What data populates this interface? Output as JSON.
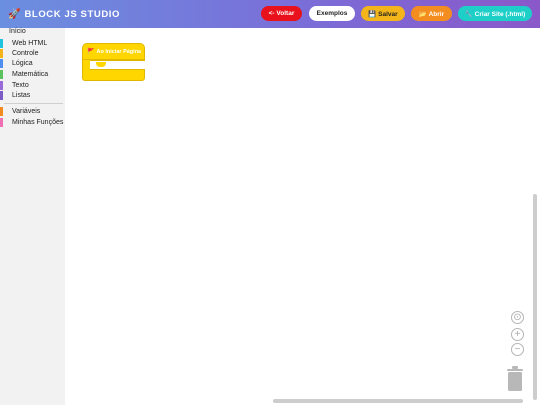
{
  "header": {
    "title": "BLOCK JS STUDIO",
    "icon": "rocket-icon",
    "gradient": [
      "#6b8fe0",
      "#8a58c9"
    ],
    "buttons": {
      "back": "<- Voltar",
      "examples": "Exemplos",
      "save": "💾 Salvar",
      "open": "📂 Abrir",
      "create": "🔧 Criar Site (.html)"
    }
  },
  "toolbox": {
    "start": "Início",
    "categories": [
      {
        "label": "Web HTML",
        "color": "#1ec3e0"
      },
      {
        "label": "Controle",
        "color": "#f4b41a"
      },
      {
        "label": "Lógica",
        "color": "#4f8ff2"
      },
      {
        "label": "Matemática",
        "color": "#5cc25e"
      },
      {
        "label": "Texto",
        "color": "#9b6ad9"
      },
      {
        "label": "Listas",
        "color": "#7b5bc5"
      }
    ],
    "extra": [
      {
        "label": "Variáveis",
        "color": "#f38a1f"
      },
      {
        "label": "Minhas Funções",
        "color": "#ef6fb5"
      }
    ]
  },
  "workspace": {
    "block": {
      "label": "Ao Iniciar Página",
      "color": "#ffd600",
      "icon": "flag-icon"
    }
  },
  "controls": {
    "zoom_center": "⊙",
    "zoom_in": "+",
    "zoom_out": "−"
  }
}
